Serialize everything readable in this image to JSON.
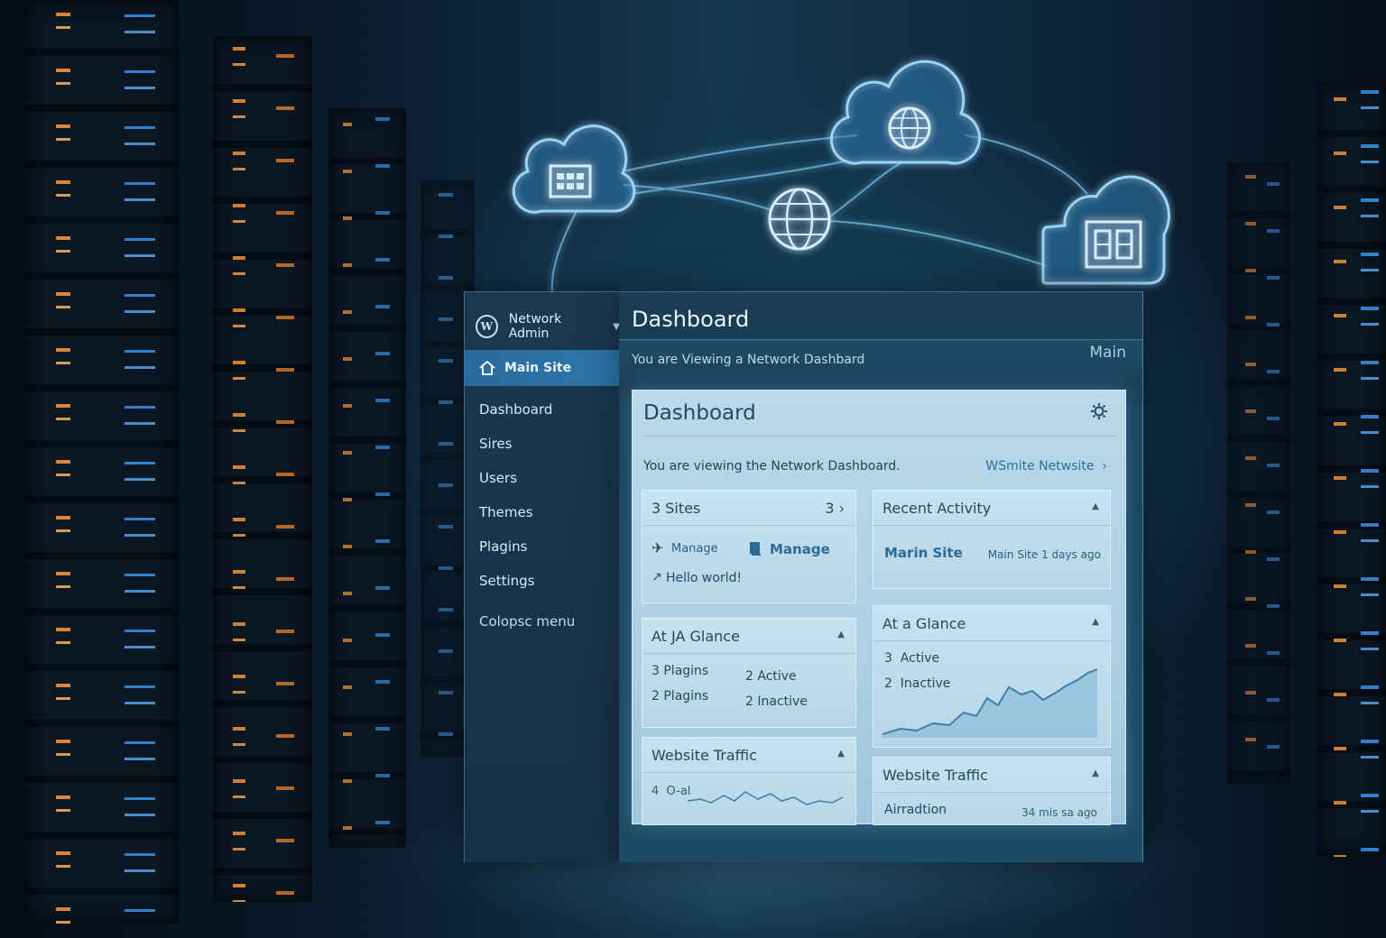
{
  "sidebar": {
    "network_admin": "Network Admin",
    "active_site": "Main Site",
    "items": [
      "Dashboard",
      "Sires",
      "Users",
      "Themes",
      "Plagins",
      "Settings"
    ],
    "collapse": "Colopsc menu"
  },
  "content": {
    "title": "Dashboard",
    "viewing": "You are Viewing a Network Dashbard",
    "site_label": "Main"
  },
  "card": {
    "title": "Dashboard",
    "description": "You are viewing the Network Dashboard.",
    "link": "WSmite Netwsite"
  },
  "panels": {
    "sites": {
      "title": "3 Sites",
      "count": "3",
      "manage_small": "Manage",
      "manage_large": "Manage",
      "post": "Hello world!"
    },
    "recent": {
      "title": "Recent Activity",
      "site": "Marin Site",
      "meta": "Main Site 1 days ago"
    },
    "glance1": {
      "title": "At JA Glance",
      "left": [
        "3 Plagins",
        "2 Plagins"
      ],
      "right": [
        "2 Active",
        "2 Inactive"
      ]
    },
    "glance2": {
      "title": "At a Glance",
      "lines": [
        "3  Active",
        "2  Inactive"
      ]
    },
    "traffic1": {
      "title": "Website Traffic",
      "value": "4  O-al"
    },
    "traffic2": {
      "title": "Website Traffic",
      "label": "Airradtion",
      "time": "34 mis sa ago"
    }
  },
  "icons": {
    "clouds": [
      "grid-cloud-icon",
      "globe-cloud-icon",
      "panel-cloud-icon"
    ],
    "hub": "globe-icon",
    "accent": "#2d77ad",
    "glow": "#7fc4ee"
  }
}
